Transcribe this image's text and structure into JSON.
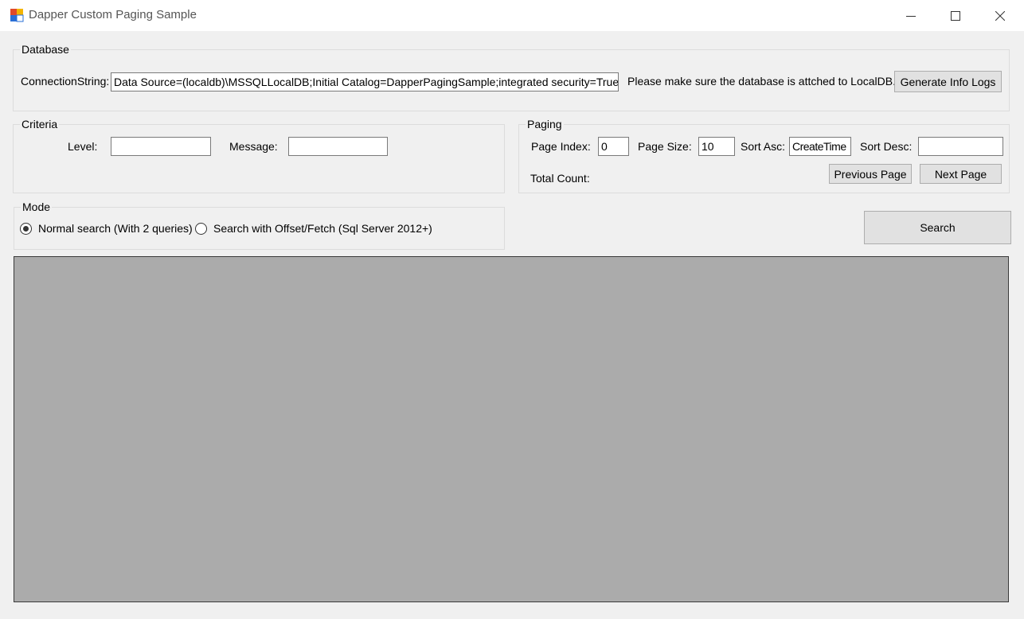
{
  "window": {
    "title": "Dapper Custom Paging Sample",
    "controls": [
      "minimize-icon",
      "maximize-icon",
      "close-icon"
    ]
  },
  "database": {
    "legend": "Database",
    "connection_label": "ConnectionString:",
    "connection_value": "Data Source=(localdb)\\MSSQLLocalDB;Initial Catalog=DapperPagingSample;integrated security=True;",
    "note": "Please make sure the database is attched to LocalDB.",
    "generate_button": "Generate Info Logs"
  },
  "criteria": {
    "legend": "Criteria",
    "level_label": "Level:",
    "level_value": "",
    "message_label": "Message:",
    "message_value": ""
  },
  "paging": {
    "legend": "Paging",
    "page_index_label": "Page Index:",
    "page_index_value": "0",
    "page_size_label": "Page Size:",
    "page_size_value": "10",
    "sort_asc_label": "Sort Asc:",
    "sort_asc_value": "CreateTime",
    "sort_desc_label": "Sort Desc:",
    "sort_desc_value": "",
    "total_count_label": "Total Count:",
    "previous_button": "Previous Page",
    "next_button": "Next Page"
  },
  "mode": {
    "legend": "Mode",
    "options": [
      {
        "label": "Normal search (With 2 queries)",
        "selected": true
      },
      {
        "label": "Search with Offset/Fetch (Sql Server 2012+)",
        "selected": false
      }
    ]
  },
  "search_button": "Search",
  "colors": {
    "window_bg": "#f0f0f0",
    "grid_bg": "#ababab",
    "button_bg": "#e1e1e1"
  }
}
